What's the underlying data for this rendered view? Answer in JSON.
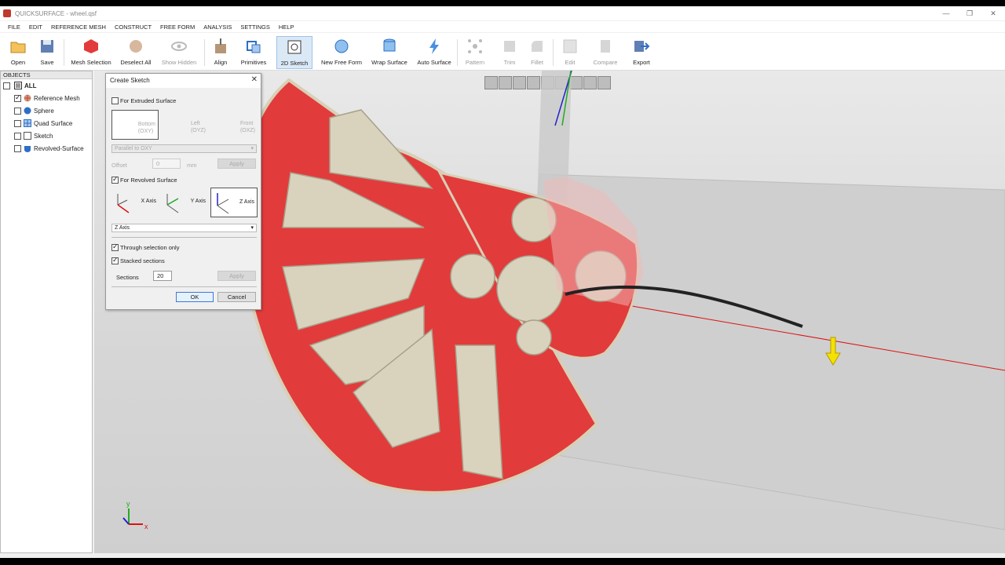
{
  "window": {
    "title": "QUICKSURFACE - wheel.qsf"
  },
  "menu": [
    "FILE",
    "EDIT",
    "REFERENCE MESH",
    "CONSTRUCT",
    "FREE FORM",
    "ANALYSIS",
    "SETTINGS",
    "HELP"
  ],
  "toolbar": {
    "open": "Open",
    "save": "Save",
    "mesh_selection": "Mesh Selection",
    "deselect_all": "Deselect All",
    "show_hidden": "Show Hidden",
    "align": "Align",
    "primitives": "Primitives",
    "sketch_2d": "2D Sketch",
    "new_free_form": "New Free Form",
    "wrap_surface": "Wrap Surface",
    "auto_surface": "Auto Surface",
    "pattern": "Pattern",
    "trim": "Trim",
    "fillet": "Fillet",
    "edit": "Edit",
    "compare": "Compare",
    "export": "Export"
  },
  "objects": {
    "header": "OBJECTS",
    "all": "ALL",
    "items": [
      {
        "label": "Reference Mesh",
        "checked": true,
        "icon": "mesh-icon"
      },
      {
        "label": "Sphere",
        "checked": false,
        "icon": "sphere-icon"
      },
      {
        "label": "Quad Surface",
        "checked": false,
        "icon": "quad-surface-icon"
      },
      {
        "label": "Sketch",
        "checked": false,
        "icon": "sketch-icon"
      },
      {
        "label": "Revolved-Surface",
        "checked": false,
        "icon": "revolved-surface-icon"
      }
    ]
  },
  "dialog": {
    "title": "Create Sketch",
    "extruded_label": "For Extruded Surface",
    "extruded_checked": false,
    "plane_bottom": "Bottom\n(OXY)",
    "plane_left": "Left\n(OYZ)",
    "plane_front": "Front\n(OXZ)",
    "plane_select": "Parallel to OXY",
    "offset_label": "Offset",
    "offset_value": "0",
    "offset_unit": "mm",
    "apply_1": "Apply",
    "revolved_label": "For Revolved Surface",
    "revolved_checked": true,
    "axis_x": "X Axis",
    "axis_y": "Y Axis",
    "axis_z": "Z Axis",
    "axis_select": "Z Axis",
    "through_selection": "Through selection only",
    "through_checked": true,
    "stacked_sections": "Stacked sections",
    "stacked_checked": true,
    "sections_label": "Sections",
    "sections_value": "20",
    "apply_2": "Apply",
    "ok": "OK",
    "cancel": "Cancel"
  },
  "triad": {
    "x": "x",
    "y": "y"
  },
  "colors": {
    "mesh_red": "#e23b3b",
    "mesh_cream": "#d9d3bd",
    "accent": "#3b7ad9",
    "axis_red": "#d11",
    "axis_green": "#2a2",
    "axis_blue": "#22c",
    "arrow_yellow": "#f5e100"
  }
}
